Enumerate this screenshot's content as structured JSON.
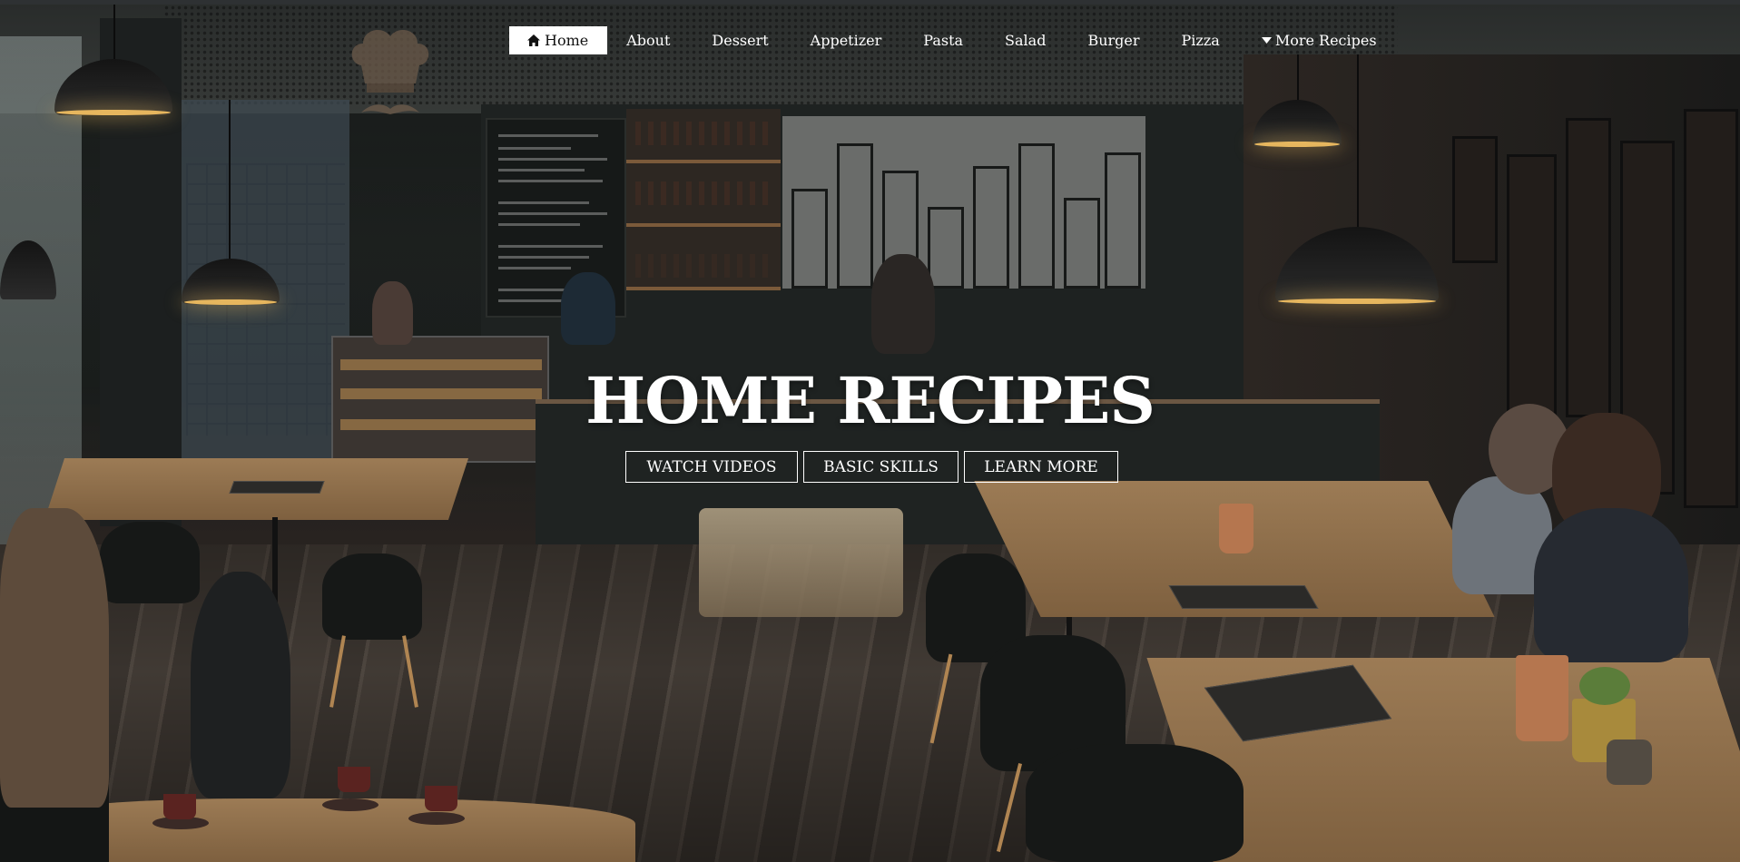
{
  "nav": {
    "items": [
      {
        "label": "Home",
        "icon": "home-icon",
        "active": true
      },
      {
        "label": "About"
      },
      {
        "label": "Dessert"
      },
      {
        "label": "Appetizer"
      },
      {
        "label": "Pasta"
      },
      {
        "label": "Salad"
      },
      {
        "label": "Burger"
      },
      {
        "label": "Pizza"
      },
      {
        "label": "More Recipes",
        "icon": "caret-down-icon"
      }
    ]
  },
  "hero": {
    "title": "HOME RECIPES",
    "buttons": [
      "WATCH VIDEOS",
      "BASIC SKILLS",
      "LEARN MORE"
    ]
  },
  "logo": {
    "icon": "chef-hat-mustache-icon"
  },
  "colors": {
    "nav_active_bg": "#ffffff",
    "text": "#ffffff",
    "overlay": "#1c1f1e"
  }
}
